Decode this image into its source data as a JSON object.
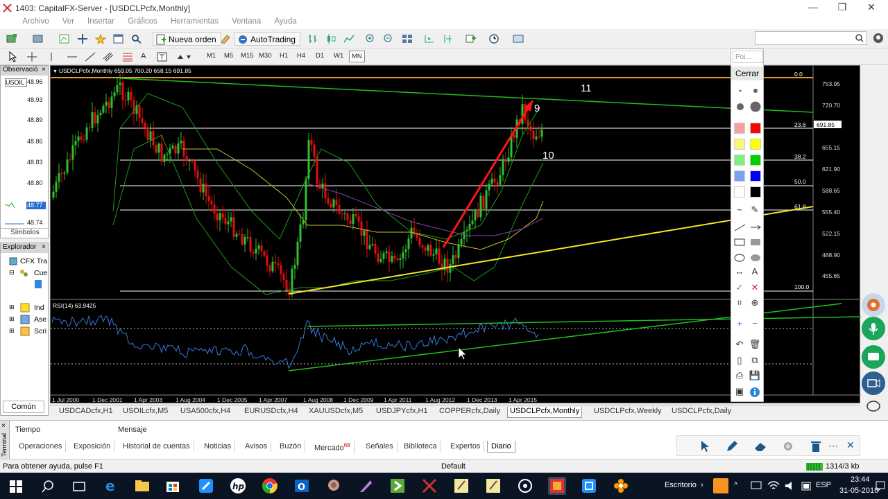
{
  "window": {
    "title": "1403: CapitalFX-Server - [USDCLPcfx,Monthly]",
    "minimize": "—",
    "restore": "❐",
    "close": "✕"
  },
  "menu": [
    "Archivo",
    "Ver",
    "Insertar",
    "Gráficos",
    "Herramientas",
    "Ventana",
    "Ayuda"
  ],
  "toolbar": {
    "new_order": "Nueva orden",
    "autotrading": "AutoTrading"
  },
  "timeframes": [
    "M1",
    "M5",
    "M15",
    "M30",
    "H1",
    "H4",
    "D1",
    "W1",
    "MN"
  ],
  "observer": {
    "title": "Observació",
    "close": "×",
    "symbol": "USOIL",
    "prices": [
      "48.96",
      "48.93",
      "48.89",
      "48.86",
      "48.83",
      "48.80",
      "48.77",
      "48.74"
    ],
    "selected_price": "48.77",
    "footer": "Símbolos"
  },
  "explorer": {
    "title": "Explorador",
    "close": "×",
    "items": [
      "CFX Tra",
      "Cue",
      "Ind",
      "Ase",
      "Scri"
    ],
    "tab": "Común"
  },
  "chart": {
    "header": "USDCLPcfx,Monthly  659.05 700.20 658.15 691.85",
    "current_price": "691.85",
    "price_axis": [
      "753.95",
      "720.70",
      "687.45",
      "655.15",
      "621.90",
      "588.65",
      "555.40",
      "522.15",
      "488.90",
      "455.65"
    ],
    "fib_levels": [
      "0.0",
      "23.6",
      "38.2",
      "50.0",
      "61.8",
      "100.0"
    ],
    "wave_labels": [
      "9",
      "10",
      "11"
    ],
    "time_axis": [
      "1 Jul 2000",
      "1 Dec 2001",
      "1 Apr 2003",
      "1 Aug 2004",
      "1 Dec 2005",
      "1 Apr 2007",
      "1 Aug 2008",
      "1 Dec 2009",
      "1 Apr 2011",
      "1 Aug 2012",
      "1 Dec 2013",
      "1 Apr 2015"
    ],
    "rsi_header": "RSI(14) 63.9425",
    "colors": {
      "bull": "#2fbf2f",
      "bear": "#e01010",
      "trend": "#f5e62a",
      "green_line": "#1fbf1f",
      "red_arrow": "#ff1515",
      "rsi": "#3a78d8",
      "orange": "#e8a020"
    }
  },
  "draw_panel": {
    "placeholder": "Poi...",
    "close": "Cerrar",
    "colors": [
      "#f7a0a0",
      "#ff0000",
      "#f8f87a",
      "#ffff00",
      "#7ef07e",
      "#00d000",
      "#7aa0f0",
      "#0000ff",
      "#ffffff",
      "#000000"
    ]
  },
  "chart_tabs": [
    "USDCADcfx,H1",
    "USOILcfx,M5",
    "USA500cfx,H4",
    "EURUSDcfx,H4",
    "XAUUSDcfx,M5",
    "USDJPYcfx,H1",
    "COPPERcfx,Daily",
    "USDCLPcfx,Monthly",
    "USDCLPcfx,Weekly",
    "USDCLPcfx,Daily"
  ],
  "active_chart_tab": "USDCLPcfx,Monthly",
  "terminal": {
    "side_label": "Terminal",
    "close": "×",
    "col_time": "Tiempo",
    "col_message": "Mensaje",
    "tabs": [
      "Operaciones",
      "Exposición",
      "Historial de cuentas",
      "Noticias",
      "Avisos",
      "Buzón",
      "Mercado",
      "Señales",
      "Biblioteca",
      "Expertos",
      "Diario"
    ],
    "market_badge": "68",
    "active_tab": "Diario"
  },
  "status": {
    "help": "Para obtener ayuda, pulse F1",
    "profile": "Default",
    "traffic": "1314/3 kb"
  },
  "taskbar": {
    "desktop": "Escritorio",
    "lang": "ESP",
    "time": "23:44",
    "date": "31-05-2016"
  }
}
